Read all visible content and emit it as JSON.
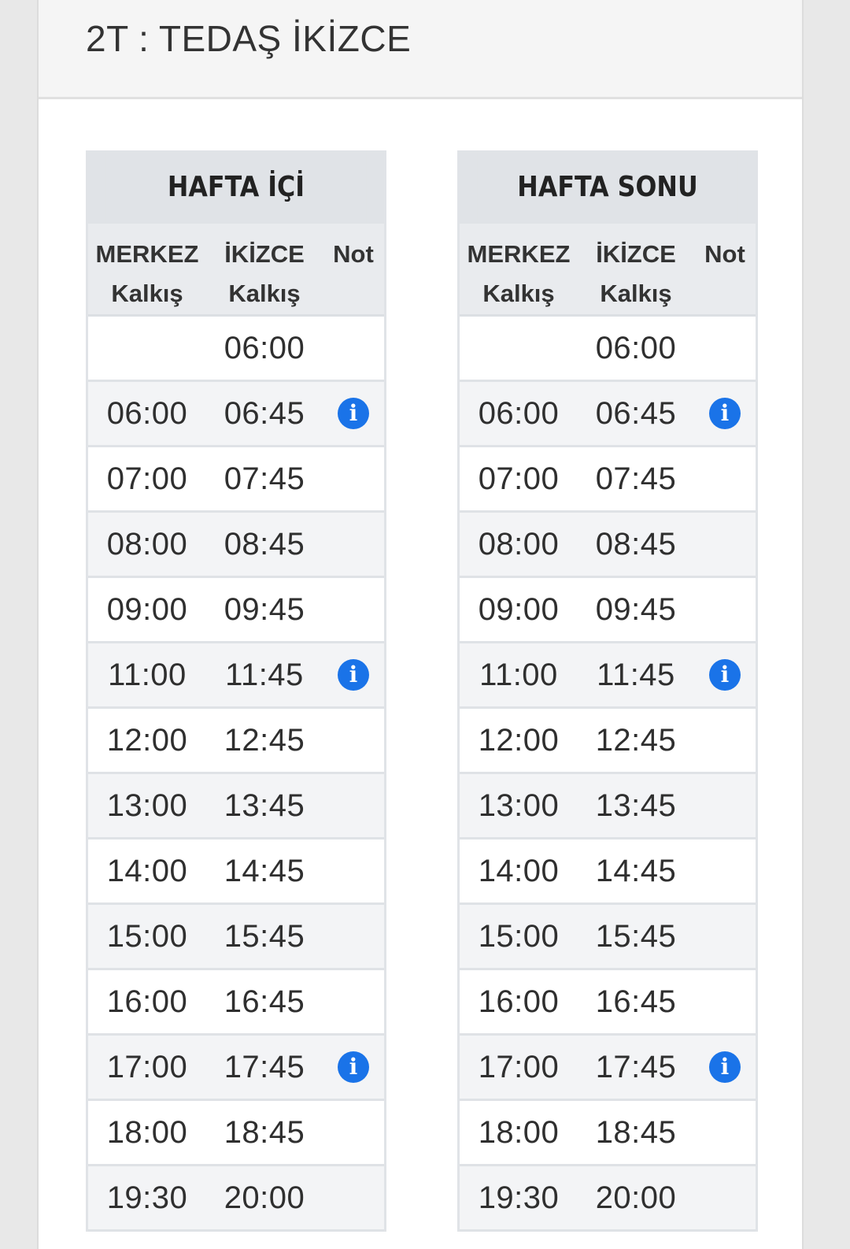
{
  "header": {
    "title": "2T : TEDAŞ İKİZCE"
  },
  "columns": {
    "merkez": [
      "MERKEZ",
      "Kalkış"
    ],
    "ikizce": [
      "İKİZCE",
      "Kalkış"
    ],
    "not": "Not"
  },
  "icons": {
    "info": "info-icon",
    "info_color": "#1a73e8"
  },
  "tables": [
    {
      "title": "HAFTA İÇİ",
      "rows": [
        {
          "merkez": "",
          "ikizce": "06:00",
          "note": false
        },
        {
          "merkez": "06:00",
          "ikizce": "06:45",
          "note": true
        },
        {
          "merkez": "07:00",
          "ikizce": "07:45",
          "note": false
        },
        {
          "merkez": "08:00",
          "ikizce": "08:45",
          "note": false
        },
        {
          "merkez": "09:00",
          "ikizce": "09:45",
          "note": false
        },
        {
          "merkez": "11:00",
          "ikizce": "11:45",
          "note": true
        },
        {
          "merkez": "12:00",
          "ikizce": "12:45",
          "note": false
        },
        {
          "merkez": "13:00",
          "ikizce": "13:45",
          "note": false
        },
        {
          "merkez": "14:00",
          "ikizce": "14:45",
          "note": false
        },
        {
          "merkez": "15:00",
          "ikizce": "15:45",
          "note": false
        },
        {
          "merkez": "16:00",
          "ikizce": "16:45",
          "note": false
        },
        {
          "merkez": "17:00",
          "ikizce": "17:45",
          "note": true
        },
        {
          "merkez": "18:00",
          "ikizce": "18:45",
          "note": false
        },
        {
          "merkez": "19:30",
          "ikizce": "20:00",
          "note": false
        }
      ]
    },
    {
      "title": "HAFTA SONU",
      "rows": [
        {
          "merkez": "",
          "ikizce": "06:00",
          "note": false
        },
        {
          "merkez": "06:00",
          "ikizce": "06:45",
          "note": true
        },
        {
          "merkez": "07:00",
          "ikizce": "07:45",
          "note": false
        },
        {
          "merkez": "08:00",
          "ikizce": "08:45",
          "note": false
        },
        {
          "merkez": "09:00",
          "ikizce": "09:45",
          "note": false
        },
        {
          "merkez": "11:00",
          "ikizce": "11:45",
          "note": true
        },
        {
          "merkez": "12:00",
          "ikizce": "12:45",
          "note": false
        },
        {
          "merkez": "13:00",
          "ikizce": "13:45",
          "note": false
        },
        {
          "merkez": "14:00",
          "ikizce": "14:45",
          "note": false
        },
        {
          "merkez": "15:00",
          "ikizce": "15:45",
          "note": false
        },
        {
          "merkez": "16:00",
          "ikizce": "16:45",
          "note": false
        },
        {
          "merkez": "17:00",
          "ikizce": "17:45",
          "note": true
        },
        {
          "merkez": "18:00",
          "ikizce": "18:45",
          "note": false
        },
        {
          "merkez": "19:30",
          "ikizce": "20:00",
          "note": false
        }
      ]
    }
  ]
}
